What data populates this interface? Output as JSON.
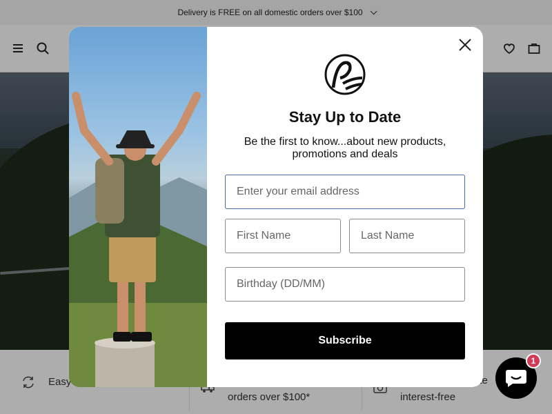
{
  "announcement": {
    "text": "Delivery is FREE on all domestic orders over $100"
  },
  "header": {
    "icons": [
      "menu-icon",
      "search-icon",
      "heart-icon",
      "bag-icon"
    ]
  },
  "features": [
    {
      "icon": "refresh-icon",
      "label": "Easy Returns/Exchanges"
    },
    {
      "icon": "truck-icon",
      "label": "orders over $100*"
    },
    {
      "icon": "camera-icon",
      "label": "interest-free",
      "label_partial": "ate"
    }
  ],
  "chat": {
    "badge_count": "1"
  },
  "modal": {
    "title": "Stay Up to Date",
    "subtitle_line1": "Be the first to know...about new products,",
    "subtitle_line2": "promotions and deals",
    "email_placeholder": "Enter your email address",
    "first_name_placeholder": "First Name",
    "last_name_placeholder": "Last Name",
    "birthday_placeholder": "Birthday (DD/MM)",
    "subscribe_label": "Subscribe"
  },
  "colors": {
    "accent": "#000000",
    "badge": "#d33a57",
    "focus_border": "#4a6aa6"
  }
}
